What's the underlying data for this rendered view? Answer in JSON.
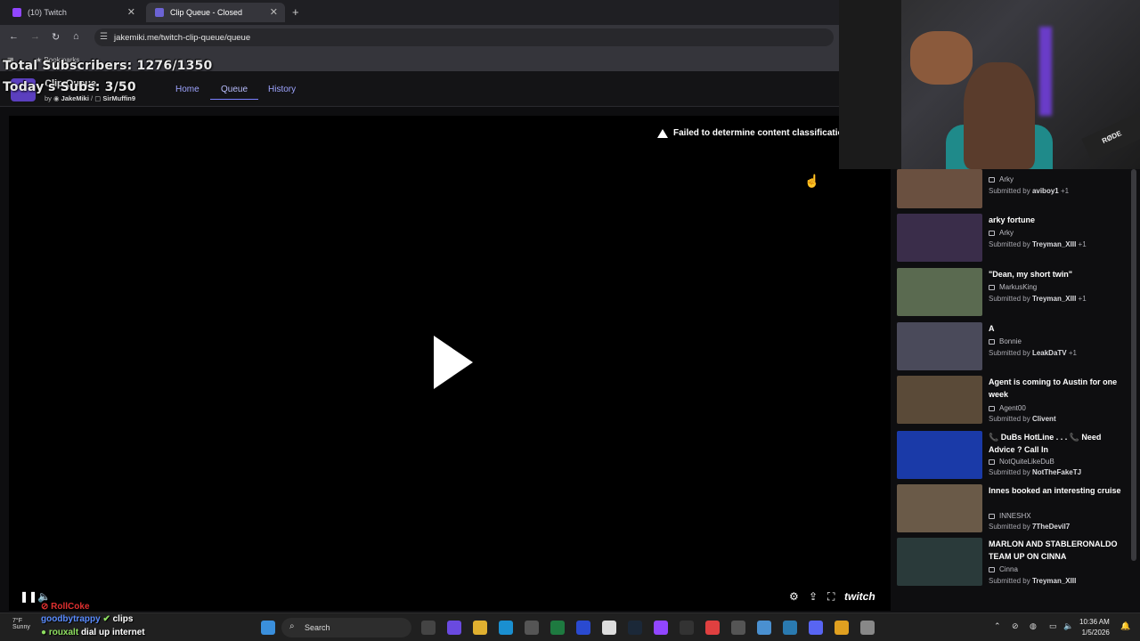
{
  "browser": {
    "tabs": [
      {
        "label": "(10) Twitch",
        "favicon_color": "#9146ff"
      },
      {
        "label": "Clip Queue - Closed",
        "favicon_color": "#6c63d4"
      }
    ],
    "url": "jakemiki.me/twitch-clip-queue/queue",
    "bookmarks_label": "Bookmarks"
  },
  "overlay": {
    "total_subscribers": "Total Subscribers: 1276/1350",
    "todays_subs": "Today's Subs: 3/50"
  },
  "app": {
    "title": "Clip Queue",
    "by_label": "by",
    "author1": "JakeMiki",
    "author2": "SirMuffin9",
    "nav": [
      {
        "label": "Home"
      },
      {
        "label": "Queue"
      },
      {
        "label": "History"
      }
    ]
  },
  "player": {
    "warning": "Failed to determine content classification",
    "brand": "twitch"
  },
  "queue": [
    {
      "title": "",
      "channel": "Arky",
      "submitted_prefix": "Submitted by",
      "submitter": "aviboy1",
      "extra": "+1",
      "thumb_color": "#6a5040"
    },
    {
      "title": "arky fortune",
      "channel": "Arky",
      "submitted_prefix": "Submitted by",
      "submitter": "Treyman_XIII",
      "extra": "+1",
      "thumb_color": "#3a2d4a"
    },
    {
      "title": "\"Dean, my short twin\"",
      "channel": "MarkusKing",
      "submitted_prefix": "Submitted by",
      "submitter": "Treyman_XIII",
      "extra": "+1",
      "thumb_color": "#5a6a50"
    },
    {
      "title": "A",
      "channel": "Bonnie",
      "submitted_prefix": "Submitted by",
      "submitter": "LeakDaTV",
      "extra": "+1",
      "thumb_color": "#4a4a5a"
    },
    {
      "title": "Agent is coming to Austin for one week",
      "channel": "Agent00",
      "submitted_prefix": "Submitted by",
      "submitter": "Clivent",
      "extra": "",
      "thumb_color": "#5a4a38"
    },
    {
      "title": "📞 DuBs HotLine . . . 📞 Need Advice ? Call In",
      "channel": "NotQuiteLikeDuB",
      "submitted_prefix": "Submitted by",
      "submitter": "NotTheFakeTJ",
      "extra": "",
      "thumb_color": "#1a3aa8"
    },
    {
      "title": "Innes booked an interesting cruise",
      "channel": "INNESHX",
      "submitted_prefix": "Submitted by",
      "submitter": "7TheDevil7",
      "extra": "",
      "thumb_color": "#6a5a48"
    },
    {
      "title": "MARLON AND STABLERONALDO TEAM UP ON CINNA",
      "channel": "Cinna",
      "submitted_prefix": "Submitted by",
      "submitter": "Treyman_XIII",
      "extra": "",
      "thumb_color": "#2a3a3a"
    }
  ],
  "webcam": {
    "mic_label": "RØDE"
  },
  "chat": [
    {
      "user": "RollCoke",
      "message": "",
      "color": "#e03030"
    },
    {
      "user": "goodbytrappy",
      "message": "clips",
      "color": "#5a8cff"
    },
    {
      "user": "rouxalt",
      "message": "dial up internet",
      "color": "#8fe060"
    }
  ],
  "taskbar": {
    "search_placeholder": "Search",
    "weather_temp": "7°F",
    "weather_desc": "Sunny",
    "time": "10:36 AM",
    "date": "1/5/2026"
  }
}
